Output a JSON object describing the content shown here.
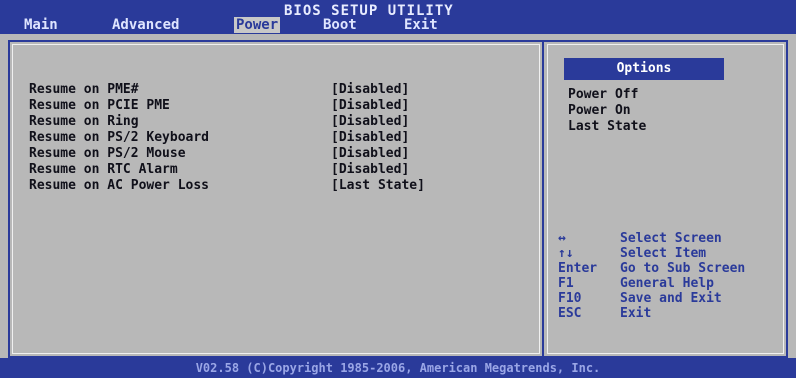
{
  "header": {
    "title": "BIOS SETUP UTILITY",
    "tabs": [
      {
        "label": "Main"
      },
      {
        "label": "Advanced"
      },
      {
        "label": "Power"
      },
      {
        "label": "Boot"
      },
      {
        "label": "Exit"
      }
    ],
    "active_tab": "Power"
  },
  "settings": [
    {
      "label": "Resume on PME#",
      "value": "[Disabled]"
    },
    {
      "label": "Resume on PCIE PME",
      "value": "[Disabled]"
    },
    {
      "label": "Resume on Ring",
      "value": "[Disabled]"
    },
    {
      "label": "Resume on PS/2 Keyboard",
      "value": "[Disabled]"
    },
    {
      "label": "Resume on PS/2 Mouse",
      "value": "[Disabled]"
    },
    {
      "label": "Resume on RTC Alarm",
      "value": "[Disabled]"
    },
    {
      "label": "Resume on AC Power Loss",
      "value": "[Last State]"
    }
  ],
  "options": {
    "header": "Options",
    "items": [
      "Power Off",
      "Power On",
      "Last State"
    ]
  },
  "help": [
    {
      "key": "↔",
      "desc": "Select Screen"
    },
    {
      "key": "↑↓",
      "desc": "Select Item"
    },
    {
      "key": "Enter",
      "desc": "Go to Sub Screen"
    },
    {
      "key": "F1",
      "desc": "General Help"
    },
    {
      "key": "F10",
      "desc": "Save and Exit"
    },
    {
      "key": "ESC",
      "desc": "Exit"
    }
  ],
  "footer": "V02.58 (C)Copyright 1985-2006, American Megatrends, Inc.",
  "colors": {
    "accent": "#2a3a9a",
    "panel_bg": "#b8b8b8",
    "text": "#10101a"
  }
}
